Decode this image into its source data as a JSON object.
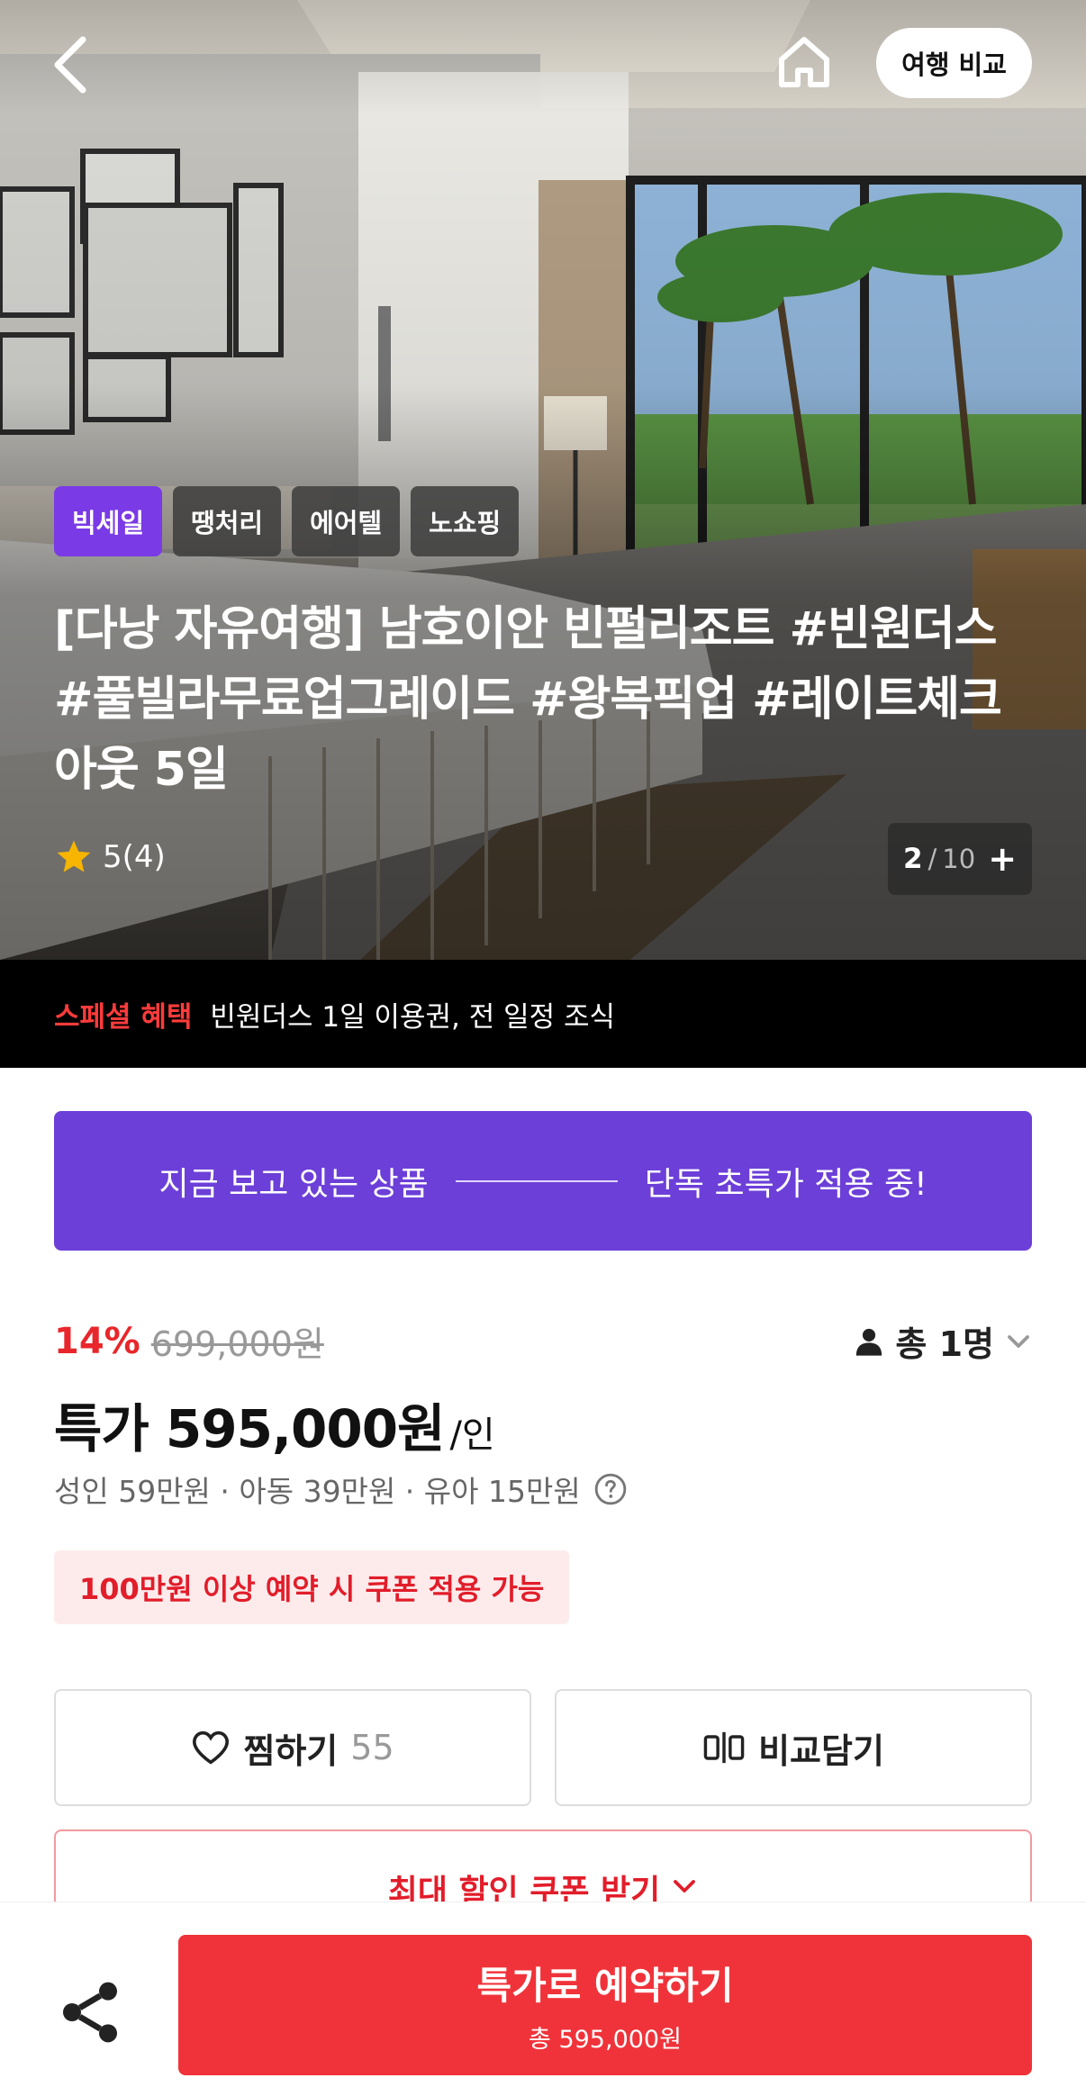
{
  "header": {
    "back_icon": "chevron-left-icon",
    "home_icon": "home-icon",
    "compare_label": "여행 비교"
  },
  "hero": {
    "badges": [
      "빅세일",
      "땡처리",
      "에어텔",
      "노쇼핑"
    ],
    "title": "[다낭 자유여행] 남호이안 빈펄리조트 #빈원더스 #풀빌라무료업그레이드 #왕복픽업 #레이트체크아웃 5일",
    "rating_text": "5(4)",
    "image_counter": {
      "current": "2",
      "separator": "/",
      "total": "10",
      "more": "+"
    }
  },
  "special": {
    "label": "스페셜 혜택",
    "text": "빈원더스 1일 이용권, 전 일정 조식"
  },
  "promo": {
    "left": "지금 보고 있는 상품",
    "right": "단독 초특가 적용 중!"
  },
  "price": {
    "discount_rate": "14%",
    "original_price": "699,000원",
    "people_label": "총 1명",
    "sale_price": "특가 595,000원",
    "unit": "/인",
    "breakdown": "성인 59만원 · 아동 39만원 · 유아 15만원",
    "coupon_note": "100만원 이상 예약 시 쿠폰 적용 가능"
  },
  "actions": {
    "like_label": "찜하기",
    "like_count": "55",
    "compare_label": "비교담기",
    "max_coupon_label": "최대 할인 쿠폰 받기"
  },
  "bottom": {
    "book_label": "특가로 예약하기",
    "book_total": "총 595,000원"
  },
  "colors": {
    "purple_badge": "#7a3ae6",
    "promo_banner": "#6c3fd8",
    "accent_red": "#f0333a",
    "special_label": "#ff3b3b",
    "star": "#f7b500"
  }
}
